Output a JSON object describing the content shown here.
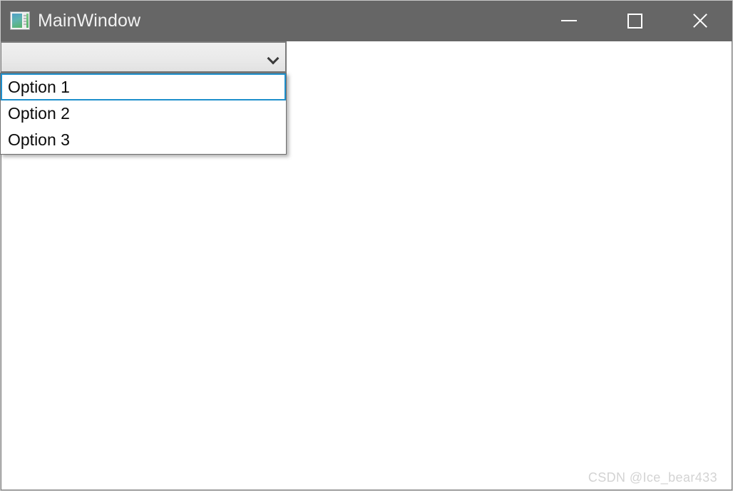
{
  "window": {
    "title": "MainWindow",
    "icon": "application-window-icon",
    "background_color": "#ffffff",
    "titlebar_color": "#666666",
    "border_color": "#7a7a7a"
  },
  "window_controls": [
    {
      "name": "minimize-button",
      "label": "Minimize",
      "glyph": "minimize-icon"
    },
    {
      "name": "maximize-button",
      "label": "Maximize",
      "glyph": "maximize-icon"
    },
    {
      "name": "close-button",
      "label": "Close",
      "glyph": "close-icon"
    }
  ],
  "combobox": {
    "value": "",
    "placeholder": "",
    "arrow_icon": "chevron-down-icon",
    "expanded": true
  },
  "dropdown": {
    "highlighted_index": 0,
    "highlight_color": "#1e8fcc",
    "items": [
      {
        "label": "Option 1"
      },
      {
        "label": "Option 2"
      },
      {
        "label": "Option 3"
      }
    ]
  },
  "watermark": {
    "text": "CSDN @Ice_bear433",
    "color": "#d3d3d3"
  }
}
